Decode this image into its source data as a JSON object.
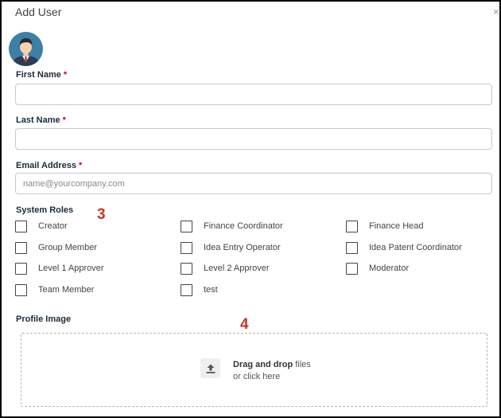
{
  "dialog": {
    "title": "Add User",
    "close_glyph": "×"
  },
  "fields": {
    "first_name": {
      "label": "First Name",
      "required_mark": "*",
      "value": ""
    },
    "last_name": {
      "label": "Last Name",
      "required_mark": "*",
      "value": ""
    },
    "email": {
      "label": "Email Address",
      "required_mark": "*",
      "value": "",
      "placeholder": "name@yourcompany.com"
    }
  },
  "system_roles": {
    "label": "System Roles",
    "annotation": "3",
    "roles": [
      {
        "label": "Creator",
        "checked": false
      },
      {
        "label": "Finance Coordinator",
        "checked": false
      },
      {
        "label": "Finance Head",
        "checked": false
      },
      {
        "label": "Group Member",
        "checked": false
      },
      {
        "label": "Idea Entry Operator",
        "checked": false
      },
      {
        "label": "Idea Patent Coordinator",
        "checked": false
      },
      {
        "label": "Level 1 Approver",
        "checked": false
      },
      {
        "label": "Level 2 Approver",
        "checked": false
      },
      {
        "label": "Moderator",
        "checked": false
      },
      {
        "label": "Team Member",
        "checked": false
      },
      {
        "label": "test",
        "checked": false
      }
    ]
  },
  "profile_image": {
    "label": "Profile Image",
    "annotation": "4",
    "drag_drop_bold": "Drag and drop",
    "drag_drop_rest": " files",
    "click_text": "or click here",
    "icon": "upload-icon"
  },
  "colors": {
    "required": "#d0021b",
    "annotation": "#c0392b",
    "avatar_bg": "#3d7fa6"
  }
}
